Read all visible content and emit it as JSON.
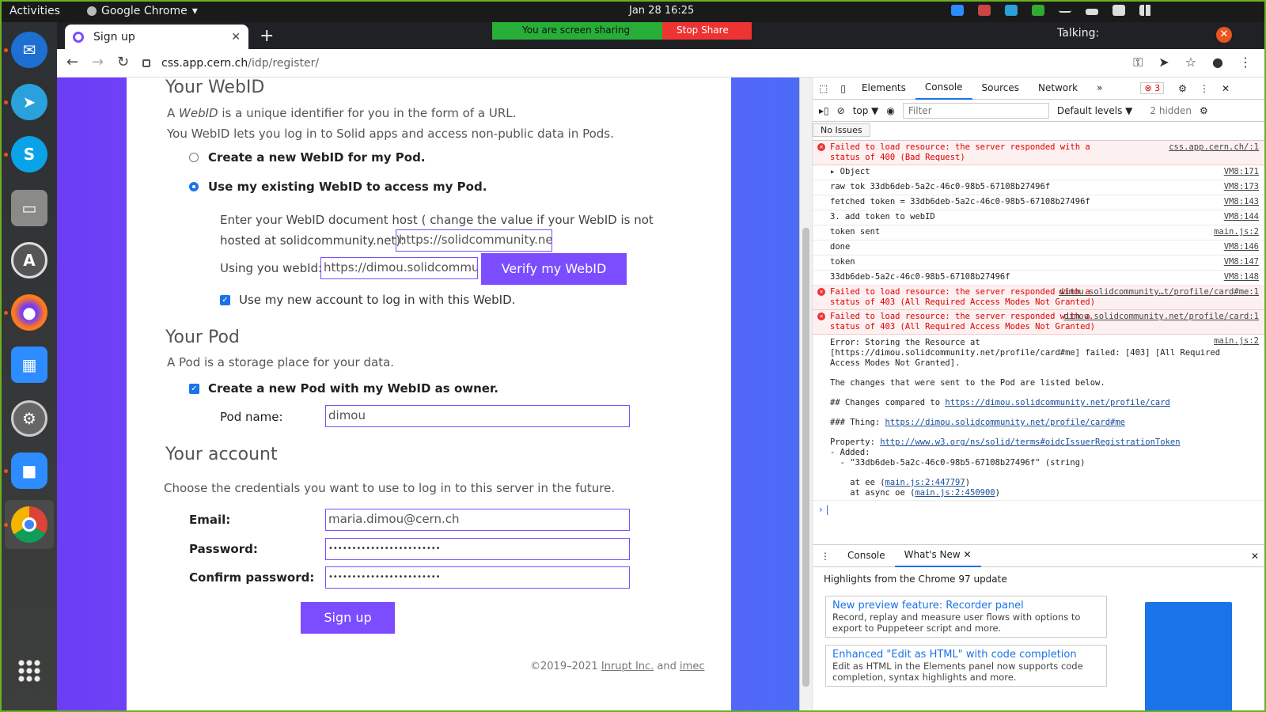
{
  "system": {
    "activities": "Activities",
    "app_menu": "Google Chrome",
    "clock": "Jan 28  16:25"
  },
  "browser": {
    "tab_title": "Sign up",
    "new_tab": "+",
    "url_host": "css.app.cern.ch",
    "url_path": "/idp/register/",
    "sharing_text": "You are screen sharing",
    "stop_share": "Stop Share",
    "talking": "Talking:"
  },
  "form": {
    "webid_heading": "Your WebID",
    "webid_desc_1_pre": "A ",
    "webid_desc_1_em": "WebID",
    "webid_desc_1_post": " is a unique identifier for you in the form of a URL.",
    "webid_desc_2": "You WebID lets you log in to Solid apps and access non-public data in Pods.",
    "option_new": "Create a new WebID for my Pod.",
    "option_existing": "Use my existing WebID to access my Pod.",
    "host_hint_1": "Enter your WebID document host ( change the value if your WebID is not",
    "host_hint_2": "hosted at solidcommunity.net):",
    "host_value": "https://solidcommunity.net",
    "using_label": "Using you webId:",
    "webid_value": "https://dimou.solidcommunity.net/profile/card#me",
    "verify_button": "Verify my WebID",
    "use_account": "Use my new account to log in with this WebID.",
    "pod_heading": "Your Pod",
    "pod_desc": "A Pod is a storage place for your data.",
    "create_pod": "Create a new Pod with my WebID as owner.",
    "pod_name_label": "Pod name:",
    "pod_name_value": "dimou",
    "account_heading": "Your account",
    "account_desc": "Choose the credentials you want to use to log in to this server in the future.",
    "email_label": "Email:",
    "email_value": "maria.dimou@cern.ch",
    "password_label": "Password:",
    "password_value": "••••••••••••••••••••••••",
    "confirm_label": "Confirm password:",
    "confirm_value": "••••••••••••••••••••••••",
    "signup_button": "Sign up",
    "footer_pre": "©2019–2021 ",
    "footer_inrupt": "Inrupt Inc.",
    "footer_and": " and ",
    "footer_imec": "imec"
  },
  "devtools": {
    "tabs": [
      "Elements",
      "Console",
      "Sources",
      "Network",
      "»"
    ],
    "error_count": "3",
    "context": "top ▼",
    "filter_placeholder": "Filter",
    "levels": "Default levels ▼",
    "hidden": "2 hidden",
    "no_issues": "No Issues",
    "logs": [
      {
        "type": "err",
        "text": "Failed to load resource: the server responded with a status of 400 (Bad Request)",
        "src": "css.app.cern.ch/:1"
      },
      {
        "type": "log",
        "text": "▸ Object",
        "src": "VM8:171"
      },
      {
        "type": "log",
        "text": "raw tok 33db6deb-5a2c-46c0-98b5-67108b27496f",
        "src": "VM8:173"
      },
      {
        "type": "log",
        "text": "fetched token = 33db6deb-5a2c-46c0-98b5-67108b27496f",
        "src": "VM8:143"
      },
      {
        "type": "log",
        "text": "3. add token to webID",
        "src": "VM8:144"
      },
      {
        "type": "log",
        "text": "token sent",
        "src": "main.js:2"
      },
      {
        "type": "log",
        "text": "done",
        "src": "VM8:146"
      },
      {
        "type": "log",
        "text": "token",
        "src": "VM8:147"
      },
      {
        "type": "log",
        "text": "33db6deb-5a2c-46c0-98b5-67108b27496f",
        "src": "VM8:148"
      },
      {
        "type": "err",
        "text": "Failed to load resource: the server responded with a status of 403 (All Required Access Modes Not Granted)",
        "src": "dimou.solidcommunity…t/profile/card#me:1"
      },
      {
        "type": "err",
        "text": "Failed to load resource: the server responded with a status of 403 (All Required Access Modes Not Granted)",
        "src": "dimou.solidcommunity.net/profile/card:1"
      }
    ],
    "error_block": {
      "line1": "Error: Storing the Resource at [https://dimou.solidcommunity.net/profile/card#me] failed: [403] [All Required Access Modes Not Granted].",
      "src": "main.js:2",
      "line2": "The changes that were sent to the Pod are listed below.",
      "line3_pre": "## Changes compared to ",
      "line3_link": "https://dimou.solidcommunity.net/profile/card",
      "line4_pre": "### Thing: ",
      "line4_link": "https://dimou.solidcommunity.net/profile/card#me",
      "line5_pre": "Property: ",
      "line5_link": "http://www.w3.org/ns/solid/terms#oidcIssuerRegistrationToken",
      "line6": "- Added:",
      "line7": "  - \"33db6deb-5a2c-46c0-98b5-67108b27496f\" (string)",
      "line8_pre": "    at ee (",
      "line8_link": "main.js:2:447797",
      "line9_pre": "    at async oe (",
      "line9_link": "main.js:2:450900"
    },
    "drawer_tabs": [
      "Console",
      "What's New"
    ],
    "whatsnew_title": "Highlights from the Chrome 97 update",
    "news": [
      {
        "title": "New preview feature: Recorder panel",
        "desc": "Record, replay and measure user flows with options to export to Puppeteer script and more."
      },
      {
        "title": "Enhanced \"Edit as HTML\" with code completion",
        "desc": "Edit as HTML in the Elements panel now supports code completion, syntax highlights and more."
      }
    ]
  }
}
